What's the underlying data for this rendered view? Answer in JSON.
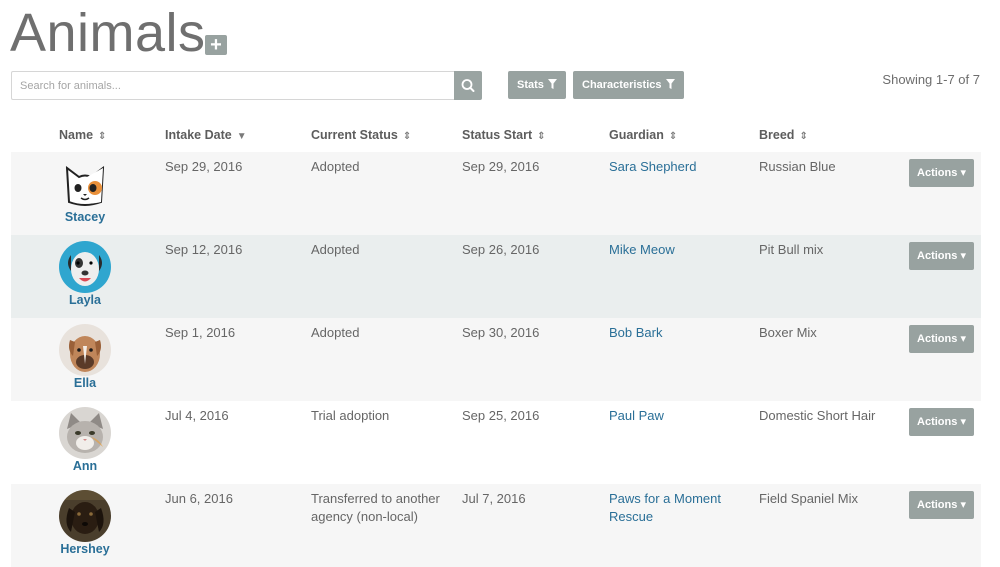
{
  "page": {
    "title": "Animals",
    "add_icon": "plus-icon",
    "showing": "Showing 1-7 of 7"
  },
  "search": {
    "placeholder": "Search for animals...",
    "value": "",
    "icon": "search-icon"
  },
  "filters": [
    {
      "label": "Stats",
      "icon": "filter-icon"
    },
    {
      "label": "Characteristics",
      "icon": "filter-icon"
    }
  ],
  "columns": [
    {
      "label": "Name",
      "sort": "both"
    },
    {
      "label": "Intake Date",
      "sort": "desc"
    },
    {
      "label": "Current Status",
      "sort": "both"
    },
    {
      "label": "Status Start",
      "sort": "both"
    },
    {
      "label": "Guardian",
      "sort": "both"
    },
    {
      "label": "Breed",
      "sort": "both"
    }
  ],
  "rows": [
    {
      "name": "Stacey",
      "intake": "Sep 29, 2016",
      "status": [
        "Adopted"
      ],
      "status_start": "Sep 29, 2016",
      "guardian": [
        "Sara Shepherd"
      ],
      "breed": "Russian Blue",
      "actions": "Actions",
      "avatar": "cat-cartoon-avatar"
    },
    {
      "name": "Layla",
      "intake": "Sep 12, 2016",
      "status": [
        "Adopted"
      ],
      "status_start": "Sep 26, 2016",
      "guardian": [
        "Mike Meow"
      ],
      "breed": "Pit Bull mix",
      "actions": "Actions",
      "avatar": "pitbull-photo-avatar"
    },
    {
      "name": "Ella",
      "intake": "Sep 1, 2016",
      "status": [
        "Adopted"
      ],
      "status_start": "Sep 30, 2016",
      "guardian": [
        "Bob Bark"
      ],
      "breed": "Boxer Mix",
      "actions": "Actions",
      "avatar": "boxer-photo-avatar"
    },
    {
      "name": "Ann",
      "intake": "Jul 4, 2016",
      "status": [
        "Trial adoption"
      ],
      "status_start": "Sep 25, 2016",
      "guardian": [
        "Paul Paw"
      ],
      "breed": "Domestic Short Hair",
      "actions": "Actions",
      "avatar": "cat-photo-avatar"
    },
    {
      "name": "Hershey",
      "intake": "Jun 6, 2016",
      "status": [
        "Transferred to another",
        "agency (non-local)"
      ],
      "status_start": "Jul 7, 2016",
      "guardian": [
        "Paws for a Moment",
        "Rescue"
      ],
      "breed": "Field Spaniel Mix",
      "actions": "Actions",
      "avatar": "spaniel-photo-avatar"
    }
  ],
  "colors": {
    "row_stripe": "#f6f6f6",
    "row_highlight": "#eaeeee",
    "button": "#98a2a0",
    "link": "#2a6f97"
  }
}
